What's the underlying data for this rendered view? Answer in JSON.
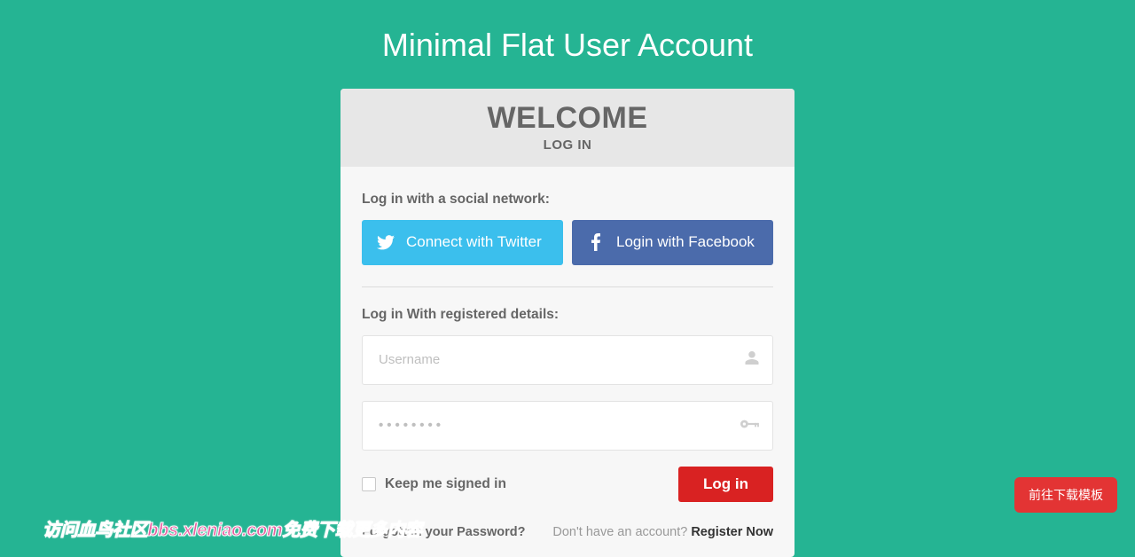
{
  "page": {
    "title": "Minimal Flat User Account"
  },
  "header": {
    "welcome": "WELCOME",
    "subtitle": "LOG IN"
  },
  "social": {
    "label": "Log in with a social network:",
    "twitter": "Connect with Twitter",
    "facebook": "Login with Facebook"
  },
  "form": {
    "label": "Log in With registered details:",
    "username_placeholder": "Username",
    "password_placeholder": "••••••••",
    "keep_signed": "Keep me signed in",
    "login_button": "Log in"
  },
  "footer": {
    "forgot": "Forgotten your Password?",
    "no_account": "Don't have an account? ",
    "register": "Register Now"
  },
  "float_button": "前往下载模板",
  "watermark": "访问血鸟社区bbs.xleniao.com免费下载更多内容",
  "colors": {
    "bg": "#25b493",
    "twitter": "#3bbfed",
    "facebook": "#4b6bab",
    "danger": "#d92222"
  }
}
